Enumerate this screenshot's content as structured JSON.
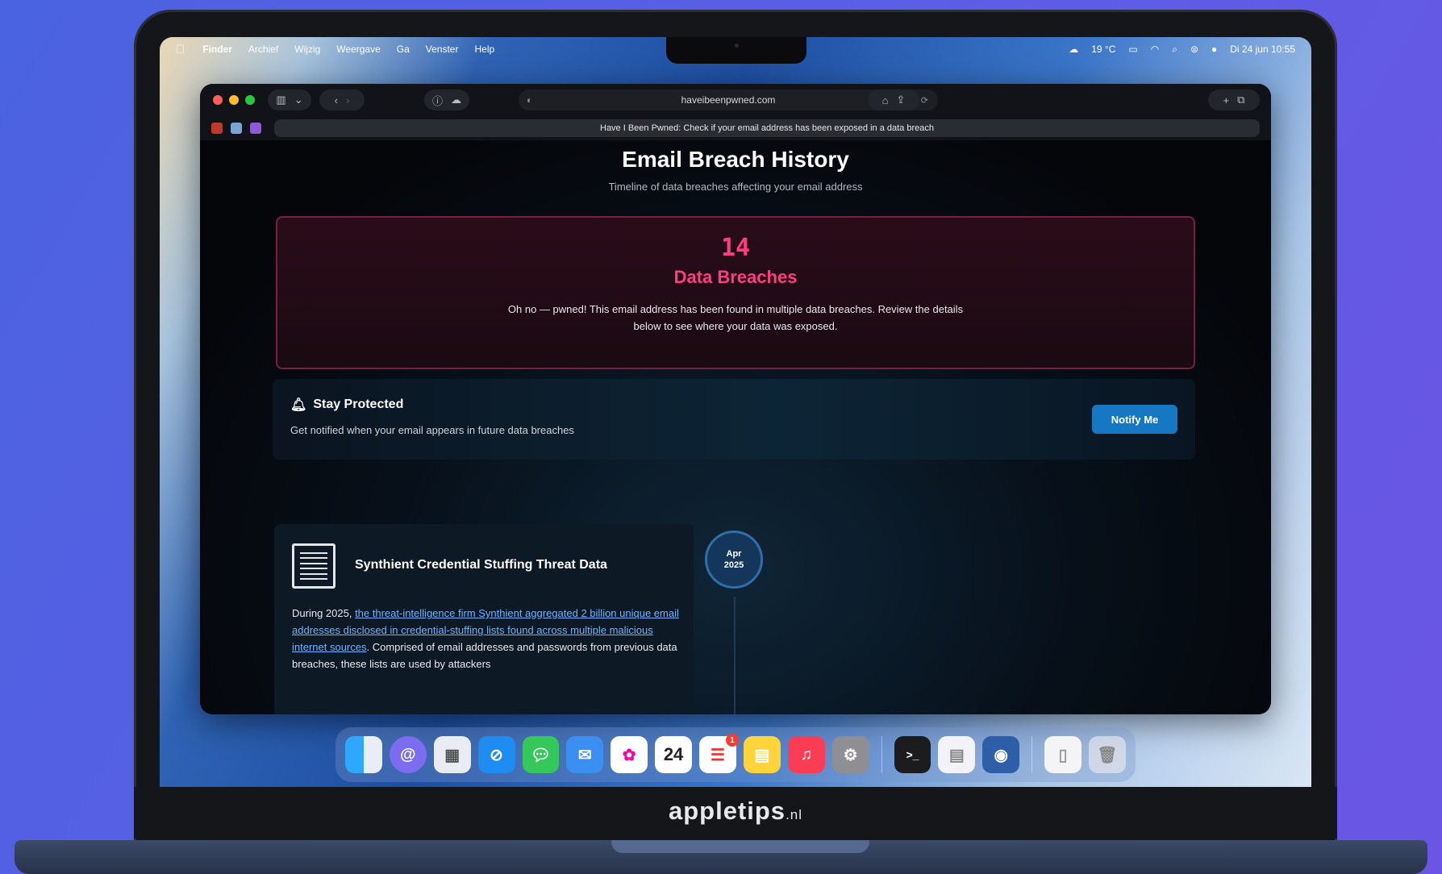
{
  "menubar": {
    "apple": "",
    "items": [
      "Finder",
      "Archief",
      "Wijzig",
      "Weergave",
      "Ga",
      "Venster",
      "Help"
    ],
    "weather": "19 °C",
    "datetime": "Di 24 jun 10:55"
  },
  "browser": {
    "url": "haveibeenpwned.com",
    "tab_title": "Have I Been Pwned: Check if your email address has been exposed in a data breach"
  },
  "page": {
    "title": "Email Breach History",
    "subtitle": "Timeline of data breaches affecting your email address",
    "breach_count": "14",
    "breach_label": "Data Breaches",
    "breach_message": "Oh no — pwned! This email address has been found in multiple data breaches. Review the details below to see where your data was exposed.",
    "protect_title": "Stay Protected",
    "protect_sub": "Get notified when your email appears in future data breaches",
    "notify_button": "Notify Me",
    "card": {
      "title": "Synthient Credential Stuffing Threat Data",
      "desc_prefix": "During 2025, ",
      "desc_link": "the threat-intelligence firm Synthient aggregated 2 billion unique email addresses disclosed in credential-stuffing lists found across multiple malicious internet sources",
      "desc_suffix": ". Comprised of email addresses and passwords from previous data breaches, these lists are used by attackers",
      "date_month": "Apr",
      "date_year": "2025"
    }
  },
  "dock": {
    "calendar_day": "24",
    "reminders_badge": "1"
  },
  "brand": {
    "name": "appletips",
    "suffix": ".nl"
  },
  "colors": {
    "accent_pink": "#ff3d7f",
    "button_blue": "#1677c2",
    "link_blue": "#6fb3ff"
  }
}
